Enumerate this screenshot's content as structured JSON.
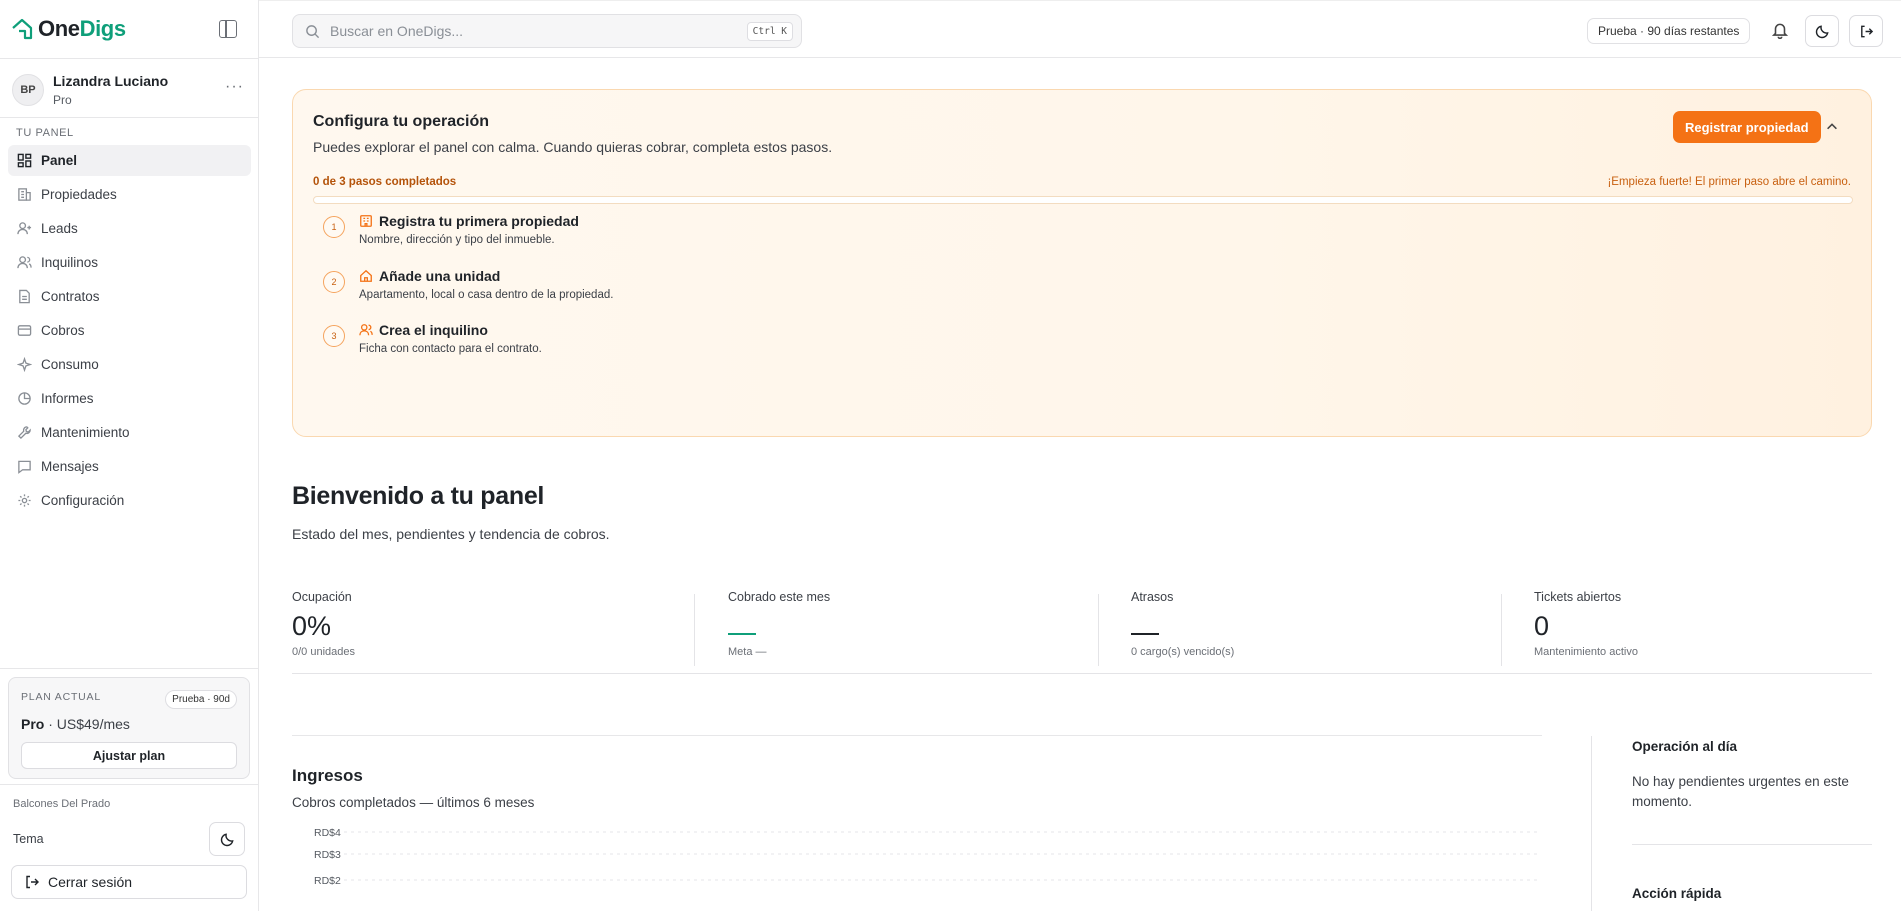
{
  "brand": {
    "prefix": "One",
    "suffix": "Digs",
    "accent_color": "#0f9f7a"
  },
  "user": {
    "initials": "BP",
    "name": "Lizandra Luciano",
    "plan": "Pro",
    "more": "···"
  },
  "sidebar": {
    "section": "TU PANEL",
    "items": [
      {
        "label": "Panel",
        "icon": "grid-icon",
        "active": true
      },
      {
        "label": "Propiedades",
        "icon": "building-icon"
      },
      {
        "label": "Leads",
        "icon": "user-plus-icon"
      },
      {
        "label": "Inquilinos",
        "icon": "users-icon"
      },
      {
        "label": "Contratos",
        "icon": "document-icon"
      },
      {
        "label": "Cobros",
        "icon": "credit-card-icon"
      },
      {
        "label": "Consumo",
        "icon": "sparkle-icon"
      },
      {
        "label": "Informes",
        "icon": "pie-chart-icon"
      },
      {
        "label": "Mantenimiento",
        "icon": "wrench-icon"
      },
      {
        "label": "Mensajes",
        "icon": "message-icon"
      },
      {
        "label": "Configuración",
        "icon": "gear-icon"
      }
    ]
  },
  "plan_card": {
    "label": "PLAN ACTUAL",
    "badge": "Prueba · 90d",
    "name": "Pro",
    "price": " · US$49/mes",
    "button": "Ajustar plan"
  },
  "sidebar_footer": {
    "org": "Balcones Del Prado",
    "theme_label": "Tema",
    "logout": "Cerrar sesión"
  },
  "topbar": {
    "search_placeholder": "Buscar en OneDigs...",
    "shortcut": "Ctrl K",
    "trial": "Prueba · 90 días restantes"
  },
  "onboarding": {
    "title": "Configura tu operación",
    "subtitle": "Puedes explorar el panel con calma. Cuando quieras cobrar, completa estos pasos.",
    "cta": "Registrar propiedad",
    "progress_label": "0 de 3 pasos completados",
    "progress_message": "¡Empieza fuerte! El primer paso abre el camino.",
    "progress_fraction": 0,
    "accent_color": "#f47215",
    "steps": [
      {
        "num": "1",
        "title": "Registra tu primera propiedad",
        "desc": "Nombre, dirección y tipo del inmueble.",
        "icon": "building-icon"
      },
      {
        "num": "2",
        "title": "Añade una unidad",
        "desc": "Apartamento, local o casa dentro de la propiedad.",
        "icon": "home-icon"
      },
      {
        "num": "3",
        "title": "Crea el inquilino",
        "desc": "Ficha con contacto para el contrato.",
        "icon": "users-icon"
      }
    ]
  },
  "welcome": {
    "title": "Bienvenido a tu panel",
    "subtitle": "Estado del mes, pendientes y tendencia de cobros."
  },
  "kpis": [
    {
      "label": "Ocupación",
      "value": "0%",
      "note": "0/0 unidades"
    },
    {
      "label": "Cobrado este mes",
      "value": "—",
      "note": "Meta —",
      "dash_color": "#0f9f7a"
    },
    {
      "label": "Atrasos",
      "value": "—",
      "note": "0 cargo(s) vencido(s)",
      "dash_color": "#1f2328"
    },
    {
      "label": "Tickets abiertos",
      "value": "0",
      "note": "Mantenimiento activo"
    }
  ],
  "income": {
    "title": "Ingresos",
    "subtitle": "Cobros completados — últimos 6 meses"
  },
  "chart_data": {
    "type": "line",
    "y_tick_labels": [
      "RD$4",
      "RD$3",
      "RD$2"
    ],
    "ylim": [
      0,
      4
    ],
    "grid": true
  },
  "side_panel": {
    "title": "Operación al día",
    "text": "No hay pendientes urgentes en este momento.",
    "title2": "Acción rápida"
  }
}
